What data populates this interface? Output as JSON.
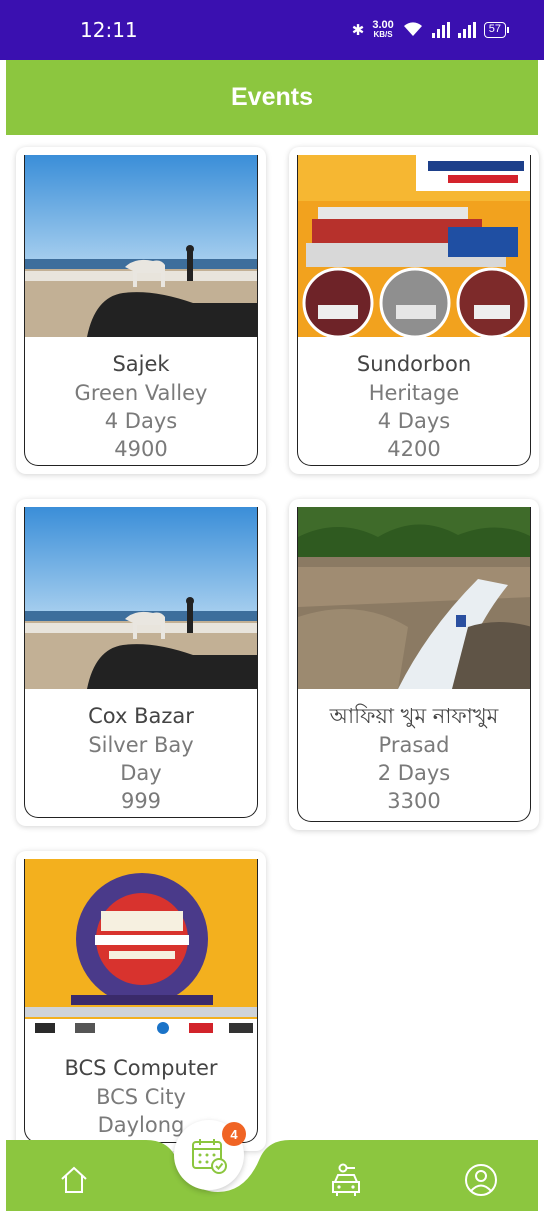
{
  "status_bar": {
    "time": "12:11",
    "net_speed": "3.00",
    "net_unit": "KB/S",
    "battery": "57"
  },
  "header": {
    "title": "Events"
  },
  "events": [
    {
      "title": "Sajek",
      "line1": "Green Valley",
      "line2": "4 Days",
      "line3": "4900"
    },
    {
      "title": "Sundorbon",
      "line1": "Heritage",
      "line2": "4 Days",
      "line3": "4200"
    },
    {
      "title": "Cox Bazar",
      "line1": "Silver Bay",
      "line2": "Day",
      "line3": "999"
    },
    {
      "title": "আফিয়া খুম নাফাখুম",
      "line1": "Prasad",
      "line2": "2 Days",
      "line3": "3300"
    },
    {
      "title": "BCS Computer",
      "line1": "BCS City",
      "line2": "Daylong",
      "line3": ""
    }
  ],
  "nav": {
    "items": [
      "home-icon",
      "events-calendar-icon",
      "travel-icon",
      "profile-icon"
    ],
    "events_badge": "4"
  },
  "colors": {
    "status_bar": "#3a10b0",
    "header": "#8cc63f",
    "badge": "#f06424"
  }
}
